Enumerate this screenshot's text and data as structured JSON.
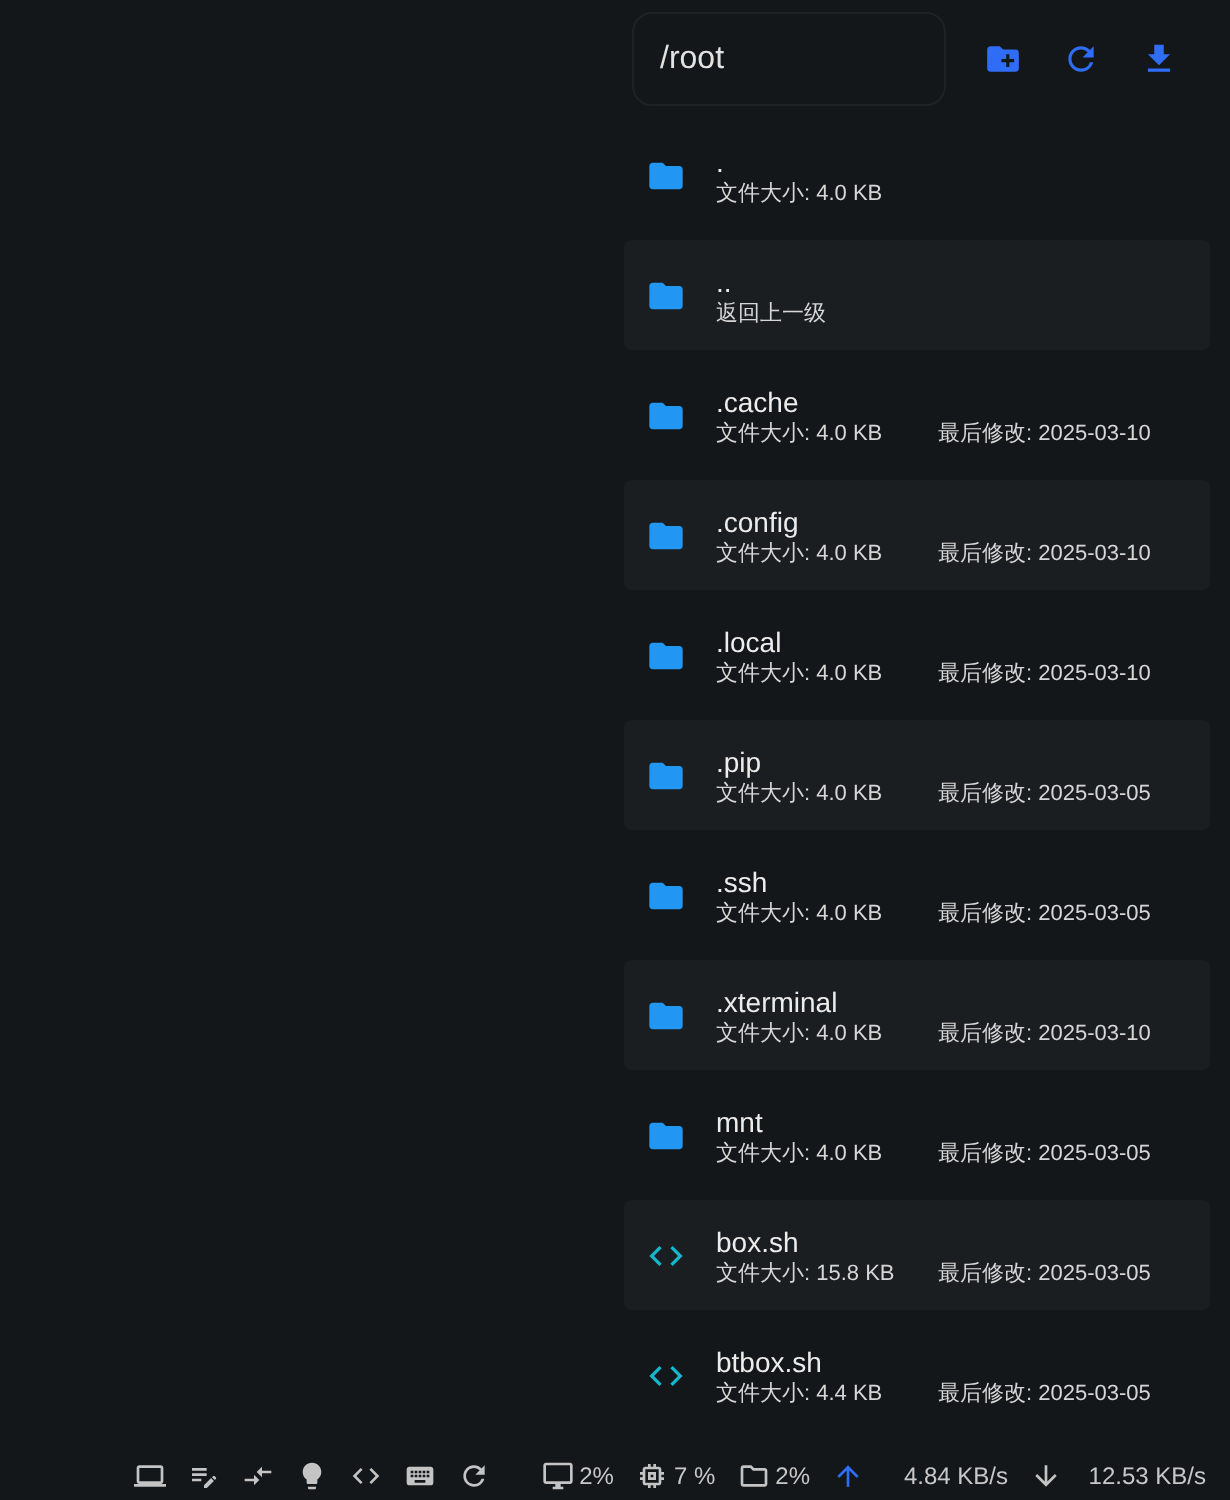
{
  "path_field": {
    "value": "/root"
  },
  "files": [
    {
      "name": ".",
      "kind": "folder",
      "details": [
        "文件大小: 4.0 KB"
      ]
    },
    {
      "name": "..",
      "kind": "folder",
      "details": [
        "返回上一级"
      ]
    },
    {
      "name": ".cache",
      "kind": "folder",
      "details": [
        "文件大小: 4.0 KB",
        "最后修改: 2025-03-10"
      ]
    },
    {
      "name": ".config",
      "kind": "folder",
      "details": [
        "文件大小: 4.0 KB",
        "最后修改: 2025-03-10"
      ]
    },
    {
      "name": ".local",
      "kind": "folder",
      "details": [
        "文件大小: 4.0 KB",
        "最后修改: 2025-03-10"
      ]
    },
    {
      "name": ".pip",
      "kind": "folder",
      "details": [
        "文件大小: 4.0 KB",
        "最后修改: 2025-03-05"
      ]
    },
    {
      "name": ".ssh",
      "kind": "folder",
      "details": [
        "文件大小: 4.0 KB",
        "最后修改: 2025-03-05"
      ]
    },
    {
      "name": ".xterminal",
      "kind": "folder",
      "details": [
        "文件大小: 4.0 KB",
        "最后修改: 2025-03-10"
      ]
    },
    {
      "name": "mnt",
      "kind": "folder",
      "details": [
        "文件大小: 4.0 KB",
        "最后修改: 2025-03-05"
      ]
    },
    {
      "name": "box.sh",
      "kind": "script",
      "details": [
        "文件大小: 15.8 KB",
        "最后修改: 2025-03-05"
      ]
    },
    {
      "name": "btbox.sh",
      "kind": "script",
      "details": [
        "文件大小: 4.4 KB",
        "最后修改: 2025-03-05"
      ]
    }
  ],
  "status_bar": {
    "stats": [
      {
        "kind": "memory",
        "value": "2%"
      },
      {
        "kind": "cpu",
        "value": "7 %"
      },
      {
        "kind": "disk",
        "value": "2%"
      },
      {
        "kind": "upload",
        "value": "4.84 KB/s"
      },
      {
        "kind": "download",
        "value": "12.53 KB/s"
      }
    ]
  }
}
